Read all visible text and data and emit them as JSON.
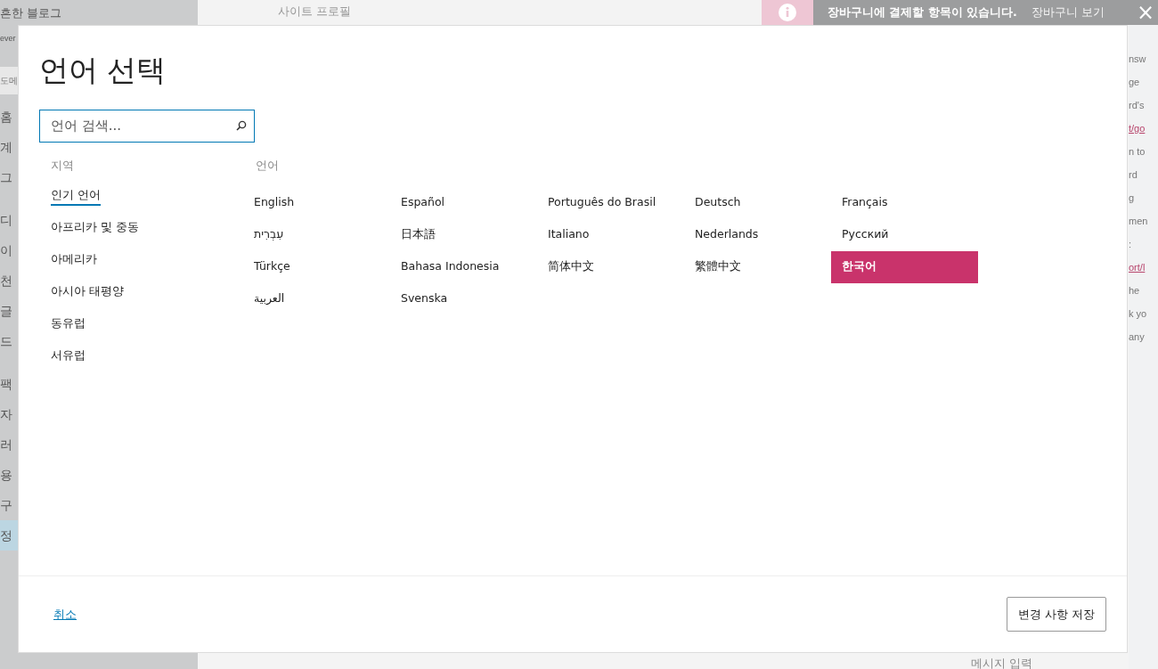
{
  "background": {
    "site_title": "흔한 블로그",
    "site_subtitle": "ever",
    "domain_item": "도메",
    "sidebar_items": [
      {
        "label": "홈",
        "selected": false
      },
      {
        "label": "계",
        "selected": false
      },
      {
        "label": "그",
        "selected": false
      },
      {
        "label": "디",
        "selected": false
      },
      {
        "label": "이",
        "selected": false
      },
      {
        "label": "천",
        "selected": false
      },
      {
        "label": "글",
        "selected": false
      },
      {
        "label": "드",
        "selected": false
      },
      {
        "label": "팩",
        "selected": false
      },
      {
        "label": "자",
        "selected": false
      },
      {
        "label": "러",
        "selected": false
      },
      {
        "label": "용",
        "selected": false
      },
      {
        "label": "구",
        "selected": false
      },
      {
        "label": "정",
        "selected": true
      }
    ],
    "tab_label": "사이트 프로필",
    "notice": {
      "text": "장바구니에 결제할 항목이 있습니다.",
      "link": "장바구니 보기",
      "close": "×"
    },
    "side_fragments": [
      {
        "text": "nsw",
        "kind": "text"
      },
      {
        "text": "ge",
        "kind": "text"
      },
      {
        "text": "rd's",
        "kind": "text"
      },
      {
        "text": "t/go",
        "kind": "link"
      },
      {
        "text": "n to",
        "kind": "text"
      },
      {
        "text": "rd",
        "kind": "text"
      },
      {
        "text": "g",
        "kind": "text"
      },
      {
        "text": "men",
        "kind": "text"
      },
      {
        "text": ":",
        "kind": "text"
      },
      {
        "text": "ort/l",
        "kind": "link"
      },
      {
        "text": "he",
        "kind": "text"
      },
      {
        "text": "k yo",
        "kind": "text"
      },
      {
        "text": "any",
        "kind": "text"
      }
    ],
    "message_placeholder": "메시지 입력"
  },
  "dialog": {
    "title": "언어 선택",
    "search": {
      "placeholder": "언어 검색..."
    },
    "region_header": "지역",
    "language_header": "언어",
    "regions": [
      {
        "label": "인기 언어",
        "selected": true
      },
      {
        "label": "아프리카 및 중동",
        "selected": false
      },
      {
        "label": "아메리카",
        "selected": false
      },
      {
        "label": "아시아 태평양",
        "selected": false
      },
      {
        "label": "동유럽",
        "selected": false
      },
      {
        "label": "서유럽",
        "selected": false
      }
    ],
    "languages": [
      {
        "label": "English",
        "selected": false
      },
      {
        "label": "Español",
        "selected": false
      },
      {
        "label": "Português do Brasil",
        "selected": false
      },
      {
        "label": "Deutsch",
        "selected": false
      },
      {
        "label": "Français",
        "selected": false
      },
      {
        "label": "עִבְרִית",
        "selected": false
      },
      {
        "label": "日本語",
        "selected": false
      },
      {
        "label": "Italiano",
        "selected": false
      },
      {
        "label": "Nederlands",
        "selected": false
      },
      {
        "label": "Русский",
        "selected": false
      },
      {
        "label": "Türkçe",
        "selected": false
      },
      {
        "label": "Bahasa Indonesia",
        "selected": false
      },
      {
        "label": "简体中文",
        "selected": false
      },
      {
        "label": "繁體中文",
        "selected": false
      },
      {
        "label": "한국어",
        "selected": true
      },
      {
        "label": "العربية",
        "selected": false
      },
      {
        "label": "Svenska",
        "selected": false
      }
    ],
    "cancel": "취소",
    "save": "변경 사항 저장"
  }
}
